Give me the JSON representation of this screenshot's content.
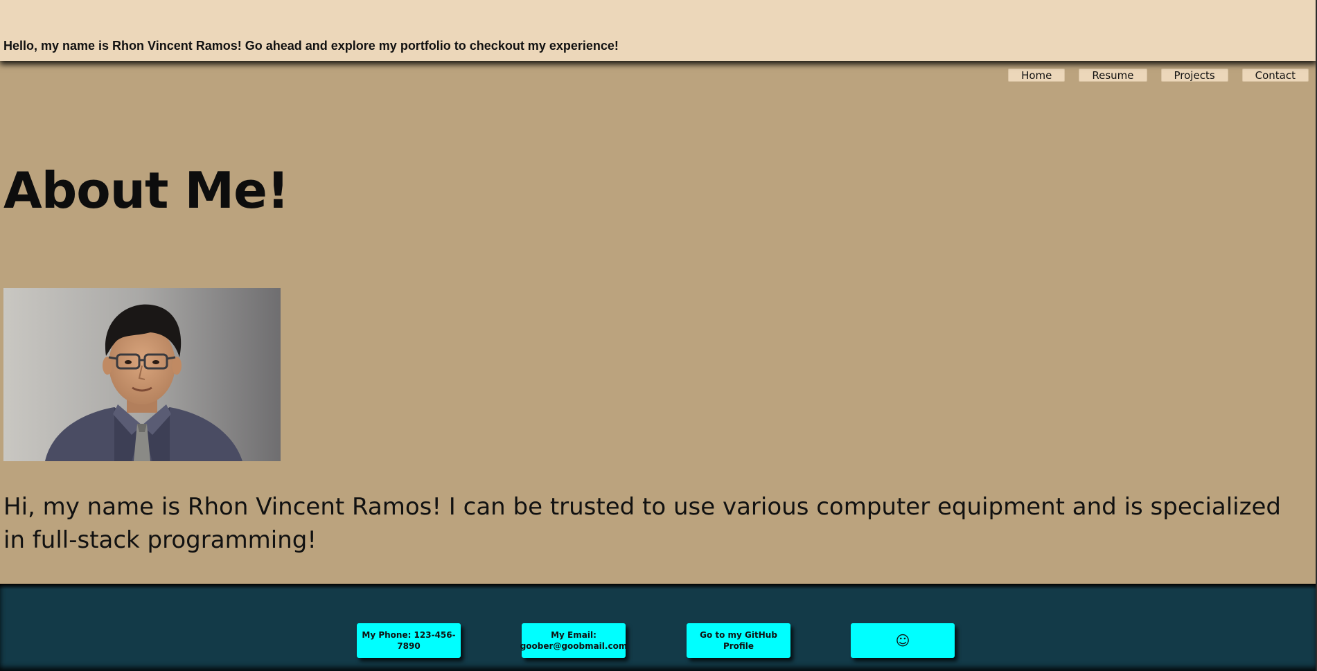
{
  "header": {
    "greeting": "Hello, my name is Rhon Vincent Ramos! Go ahead and explore my portfolio to checkout my experience!"
  },
  "nav": {
    "items": [
      {
        "label": "Home"
      },
      {
        "label": "Resume"
      },
      {
        "label": "Projects"
      },
      {
        "label": "Contact"
      }
    ]
  },
  "main": {
    "title": "About Me!",
    "portrait": {
      "subject": "portrait-photo"
    },
    "description": "Hi, my name is Rhon Vincent Ramos! I can be trusted to use various computer equipment and is specialized in full-stack programming!"
  },
  "footer": {
    "phone_label": "My Phone: 123-456-7890",
    "email_label_line1": "My Email:",
    "email_label_line2": "goober@goobmail.com",
    "github_label": "Go to my GitHub Profile",
    "smiley_label": "☺"
  },
  "colors": {
    "banner": "#ecd7ba",
    "main_bg": "#bba37e",
    "footer_bg": "#133a48",
    "contact_button": "#00ffff"
  }
}
